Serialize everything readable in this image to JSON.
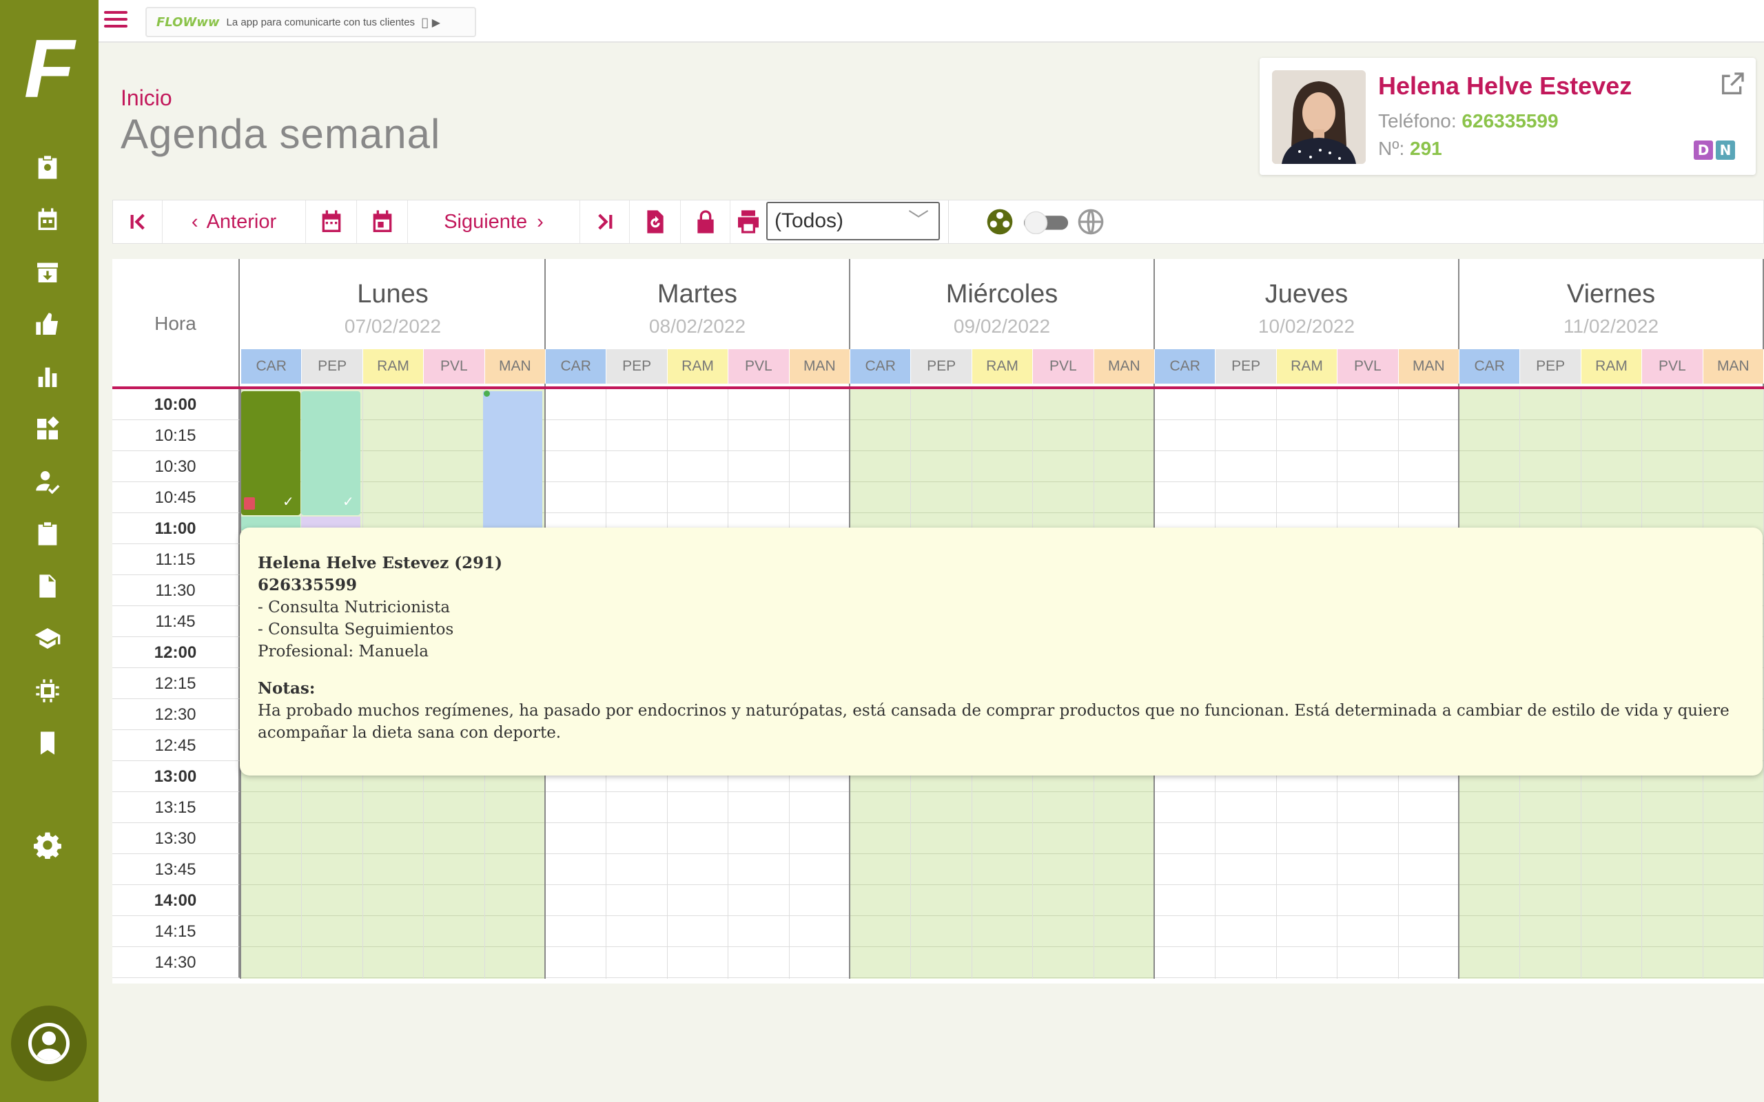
{
  "app": {
    "logo_text": "F"
  },
  "banner": {
    "brand": "FLOWww",
    "tagline": "La app para comunicarte con tus clientes",
    "stores": " ▶"
  },
  "header": {
    "breadcrumb": "Inicio",
    "title": "Agenda semanal"
  },
  "patient": {
    "name": "Helena Helve Estevez",
    "phone_label": "Teléfono:",
    "phone": "626335599",
    "number_label": "Nº:",
    "number": "291",
    "tags": [
      {
        "label": "D",
        "color": "#b05ec2"
      },
      {
        "label": "N",
        "color": "#5aa6b8"
      }
    ]
  },
  "toolbar": {
    "prev_label": "Anterior",
    "next_label": "Siguiente",
    "filter_value": "(Todos)",
    "filter_chevron": "﹀"
  },
  "calendar": {
    "hour_header": "Hora",
    "days": [
      {
        "name": "Lunes",
        "date": "07/02/2022"
      },
      {
        "name": "Martes",
        "date": "08/02/2022"
      },
      {
        "name": "Miércoles",
        "date": "09/02/2022"
      },
      {
        "name": "Jueves",
        "date": "10/02/2022"
      },
      {
        "name": "Viernes",
        "date": "11/02/2022"
      }
    ],
    "professionals": [
      "CAR",
      "PEP",
      "RAM",
      "PVL",
      "MAN"
    ],
    "professional_colors": [
      "#a8c8f0",
      "#e6e6e6",
      "#fbf3a8",
      "#f9cfe0",
      "#fbdcb0"
    ],
    "hours": [
      {
        "t": "10:00",
        "bold": true
      },
      {
        "t": "10:15"
      },
      {
        "t": "10:30"
      },
      {
        "t": "10:45"
      },
      {
        "t": "11:00",
        "bold": true
      },
      {
        "t": "11:15"
      },
      {
        "t": "11:30"
      },
      {
        "t": "11:45"
      },
      {
        "t": "12:00",
        "bold": true
      },
      {
        "t": "12:15"
      },
      {
        "t": "12:30"
      },
      {
        "t": "12:45"
      },
      {
        "t": "13:00",
        "bold": true
      },
      {
        "t": "13:15"
      },
      {
        "t": "13:30"
      },
      {
        "t": "13:45"
      },
      {
        "t": "14:00",
        "bold": true
      },
      {
        "t": "14:15"
      },
      {
        "t": "14:30"
      }
    ]
  },
  "popup": {
    "line1": "Helena Helve Estevez (291)",
    "line2": "626335599",
    "line3": "- Consulta Nutricionista",
    "line4": "- Consulta Seguimientos",
    "line5": "Profesional: Manuela",
    "notes_label": "Notas:",
    "notes": "Ha probado muchos regímenes, ha pasado por endocrinos y naturópatas, está cansada de comprar productos que no funcionan. Está determinada a cambiar de estilo de vida y quiere acompañar la dieta sana con deporte."
  },
  "colors": {
    "brand": "#c2185b",
    "sidebar": "#7a8a1c",
    "accent_green": "#8bc34a"
  }
}
